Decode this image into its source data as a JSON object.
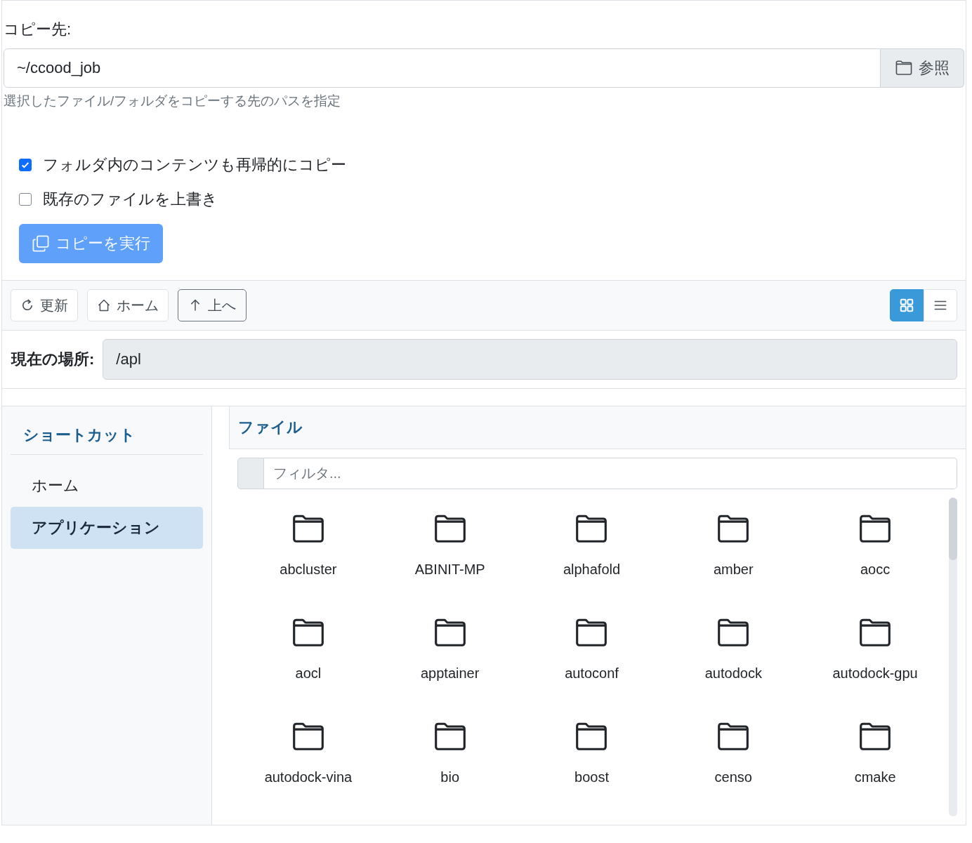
{
  "destination": {
    "label": "コピー先:",
    "value": "~/ccood_job",
    "browse_button": "参照",
    "help": "選択したファイル/フォルダをコピーする先のパスを指定"
  },
  "options": [
    {
      "label": "フォルダ内のコンテンツも再帰的にコピー",
      "checked": true
    },
    {
      "label": "既存のファイルを上書き",
      "checked": false
    }
  ],
  "copy_button": {
    "label": "コピーを実行",
    "disabled": true
  },
  "toolbar": {
    "buttons": [
      {
        "kind": "refresh",
        "label": "更新",
        "focused": false
      },
      {
        "kind": "home",
        "label": "ホーム",
        "focused": false
      },
      {
        "kind": "up",
        "label": "上へ",
        "focused": true
      }
    ],
    "view_buttons": [
      {
        "kind": "grid",
        "selected": true
      },
      {
        "kind": "list",
        "selected": false
      }
    ]
  },
  "location": {
    "label": "現在の場所:",
    "path": "/apl"
  },
  "sidebar": {
    "title": "ショートカット",
    "items": [
      {
        "label": "ホーム",
        "selected": false
      },
      {
        "label": "アプリケーション",
        "selected": true
      }
    ]
  },
  "files": {
    "title": "ファイル",
    "filter_placeholder": "フィルタ...",
    "items": [
      {
        "name": "abcluster"
      },
      {
        "name": "ABINIT-MP"
      },
      {
        "name": "alphafold"
      },
      {
        "name": "amber"
      },
      {
        "name": "aocc"
      },
      {
        "name": "aocl"
      },
      {
        "name": "apptainer"
      },
      {
        "name": "autoconf"
      },
      {
        "name": "autodock"
      },
      {
        "name": "autodock-gpu"
      },
      {
        "name": "autodock-vina"
      },
      {
        "name": "bio"
      },
      {
        "name": "boost"
      },
      {
        "name": "censo"
      },
      {
        "name": "cmake"
      }
    ]
  }
}
